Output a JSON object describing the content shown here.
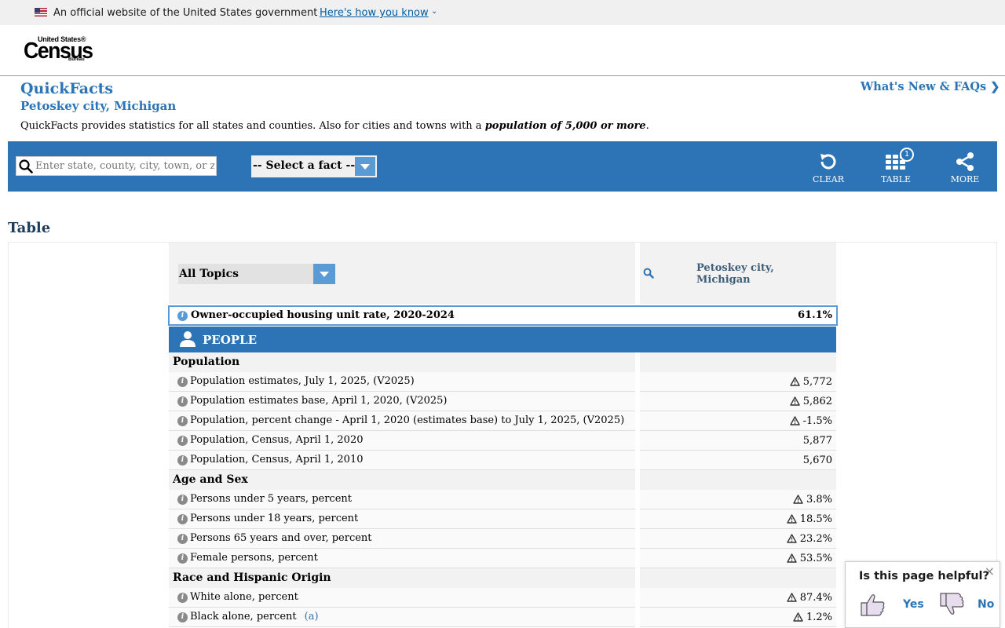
{
  "gov_banner": {
    "text": "An official website of the United States government",
    "link": "Here's how you know"
  },
  "logo": {
    "top": "United States®",
    "main": "Census",
    "bottom": "Bureau"
  },
  "page": {
    "title": "QuickFacts",
    "subtitle": "Petoskey city, Michigan",
    "description_prefix": "QuickFacts provides statistics for all states and counties. Also for cities and towns with a ",
    "description_bold": "population of 5,000 or more",
    "description_suffix": ".",
    "whats_new": "What's New & FAQs"
  },
  "toolbar": {
    "search_placeholder": "Enter state, county, city, town, or zip code",
    "fact_select": "-- Select a fact --",
    "clear_label": "CLEAR",
    "table_label": "TABLE",
    "table_badge": "1",
    "more_label": "MORE"
  },
  "table": {
    "heading": "Table",
    "topics_select": "All Topics",
    "column_header_line1": "Petoskey city,",
    "column_header_line2": "Michigan",
    "highlight": {
      "label": "Owner-occupied housing unit rate, 2020-2024",
      "value": "61.1%"
    },
    "section": "PEOPLE",
    "categories": [
      {
        "name": "Population",
        "rows": [
          {
            "label": "Population estimates, July 1, 2025, (V2025)",
            "value": "5,772",
            "warn": true
          },
          {
            "label": "Population estimates base, April 1, 2020, (V2025)",
            "value": "5,862",
            "warn": true
          },
          {
            "label": "Population, percent change - April 1, 2020 (estimates base) to July 1, 2025, (V2025)",
            "value": "-1.5%",
            "warn": true
          },
          {
            "label": "Population, Census, April 1, 2020",
            "value": "5,877",
            "warn": false
          },
          {
            "label": "Population, Census, April 1, 2010",
            "value": "5,670",
            "warn": false
          }
        ]
      },
      {
        "name": "Age and Sex",
        "rows": [
          {
            "label": "Persons under 5 years, percent",
            "value": "3.8%",
            "warn": true
          },
          {
            "label": "Persons under 18 years, percent",
            "value": "18.5%",
            "warn": true
          },
          {
            "label": "Persons 65 years and over, percent",
            "value": "23.2%",
            "warn": true
          },
          {
            "label": "Female persons, percent",
            "value": "53.5%",
            "warn": true
          }
        ]
      },
      {
        "name": "Race and Hispanic Origin",
        "rows": [
          {
            "label": "White alone, percent",
            "value": "87.4%",
            "warn": true
          },
          {
            "label": "Black alone, percent",
            "value": "1.2%",
            "warn": true,
            "note": "(a)"
          }
        ]
      }
    ]
  },
  "feedback": {
    "title": "Is this page helpful?",
    "yes": "Yes",
    "no": "No",
    "close": "×"
  },
  "colors": {
    "brand_blue": "#2c74b5",
    "select_blue": "#5b9bd5",
    "gov_link": "#005ea2"
  }
}
